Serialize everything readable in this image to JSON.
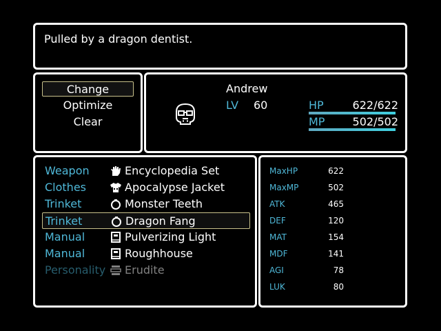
{
  "help": {
    "text": "Pulled by a dragon dentist."
  },
  "commands": {
    "items": [
      {
        "label": "Change",
        "selected": true
      },
      {
        "label": "Optimize",
        "selected": false
      },
      {
        "label": "Clear",
        "selected": false
      }
    ]
  },
  "actor": {
    "name": "Andrew",
    "face_icon": "skull-with-glasses-icon",
    "level_label": "LV",
    "level": "60",
    "hp_label": "HP",
    "hp_value": "622/622",
    "hp_fraction": 1.0,
    "mp_label": "MP",
    "mp_value": "502/502",
    "mp_fraction": 1.0
  },
  "equipment": [
    {
      "slot": "Weapon",
      "icon": "hand-icon",
      "item": "Encyclopedia Set"
    },
    {
      "slot": "Clothes",
      "icon": "shirt-icon",
      "item": "Apocalypse Jacket"
    },
    {
      "slot": "Trinket",
      "icon": "necklace-icon",
      "item": "Monster Teeth"
    },
    {
      "slot": "Trinket",
      "icon": "necklace-icon",
      "item": "Dragon Fang",
      "selected": true
    },
    {
      "slot": "Manual",
      "icon": "book-icon",
      "item": "Pulverizing Light"
    },
    {
      "slot": "Manual",
      "icon": "book-icon",
      "item": "Roughhouse"
    },
    {
      "slot": "Personality",
      "icon": "mask-icon",
      "item": "Erudite",
      "dim": true
    }
  ],
  "stats": [
    {
      "label": "MaxHP",
      "value": "622"
    },
    {
      "label": "MaxMP",
      "value": "502"
    },
    {
      "label": "ATK",
      "value": "465"
    },
    {
      "label": "DEF",
      "value": "120"
    },
    {
      "label": "MAT",
      "value": "154"
    },
    {
      "label": "MDF",
      "value": "141"
    },
    {
      "label": "AGI",
      "value": "78"
    },
    {
      "label": "LUK",
      "value": "80"
    }
  ],
  "colors": {
    "system": "#4fb8d8",
    "selection_border": "#c9c28c",
    "background": "#000000"
  }
}
